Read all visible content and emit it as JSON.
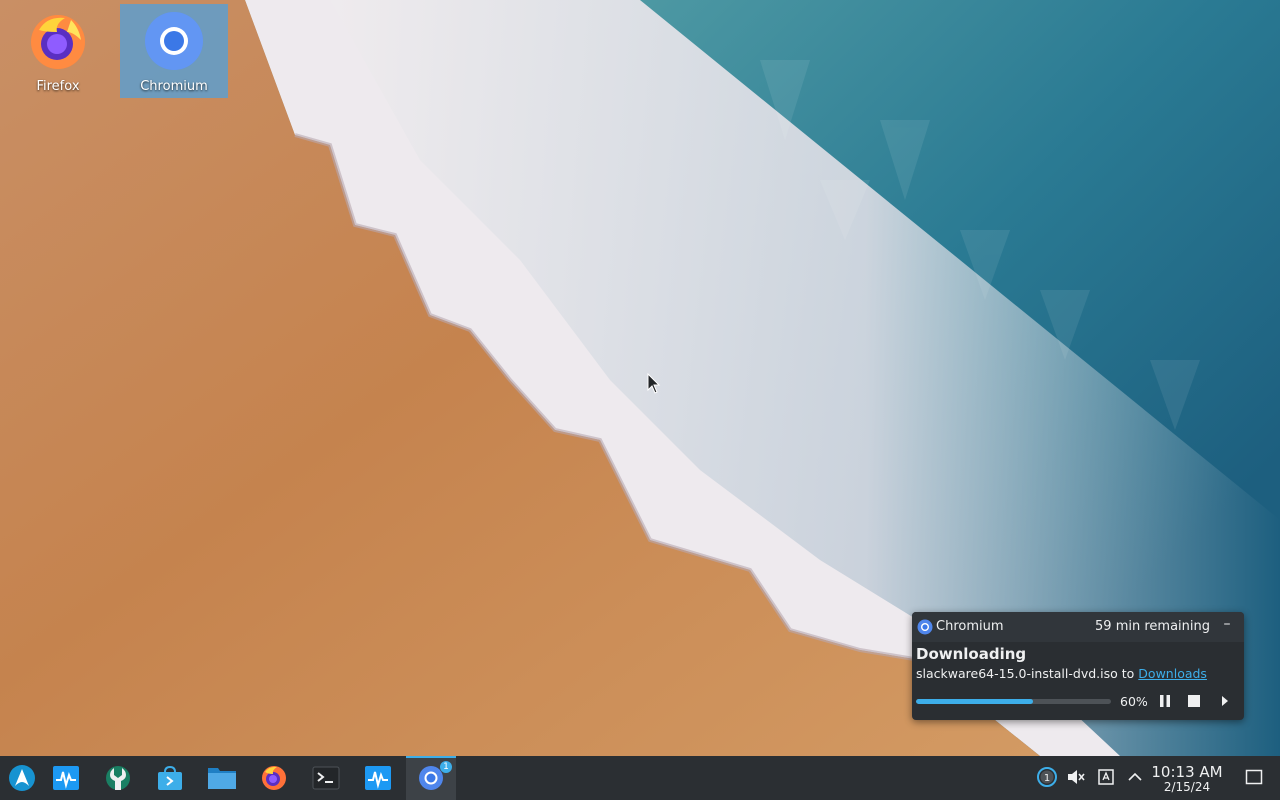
{
  "desktop": {
    "icons": [
      {
        "label": "Firefox",
        "selected": false
      },
      {
        "label": "Chromium",
        "selected": true
      }
    ]
  },
  "notification": {
    "app_name": "Chromium",
    "time_remaining": "59 min remaining",
    "minimize_label": "–",
    "title": "Downloading",
    "filename": "slackware64-15.0-install-dvd.iso",
    "connector": "to",
    "destination_link": "Downloads",
    "progress_percent": 60,
    "progress_label": "60%",
    "controls": [
      "pause-icon",
      "stop-icon",
      "expand-arrow-icon"
    ]
  },
  "taskbar": {
    "items": [
      {
        "name": "application-launcher",
        "icon": "arch-logo-icon",
        "active": false
      },
      {
        "name": "system-monitor",
        "icon": "system-monitor-icon",
        "active": false
      },
      {
        "name": "settings",
        "icon": "settings-wrench-icon",
        "active": false
      },
      {
        "name": "discover",
        "icon": "discover-store-icon",
        "active": false
      },
      {
        "name": "file-manager",
        "icon": "folder-icon",
        "active": false
      },
      {
        "name": "firefox",
        "icon": "firefox-icon",
        "active": false
      },
      {
        "name": "terminal",
        "icon": "terminal-icon",
        "active": false
      },
      {
        "name": "system-monitor-window",
        "icon": "system-monitor-icon",
        "active": false
      },
      {
        "name": "chromium",
        "icon": "chromium-icon",
        "active": true,
        "badge": "1"
      }
    ],
    "tray": {
      "notifications_count": "1",
      "icons": [
        "notification-count-icon",
        "volume-muted-icon",
        "keyboard-layout-icon",
        "show-hidden-icons-arrow"
      ]
    },
    "clock": {
      "time": "10:13 AM",
      "date": "2/15/24"
    },
    "show_desktop_icon": "show-desktop-icon"
  },
  "colors": {
    "accent": "#3daee9",
    "panel_bg": "#2b2f33",
    "notif_bg": "#2a2e32",
    "sand": "#c88a55",
    "water": "#2d7f95"
  }
}
